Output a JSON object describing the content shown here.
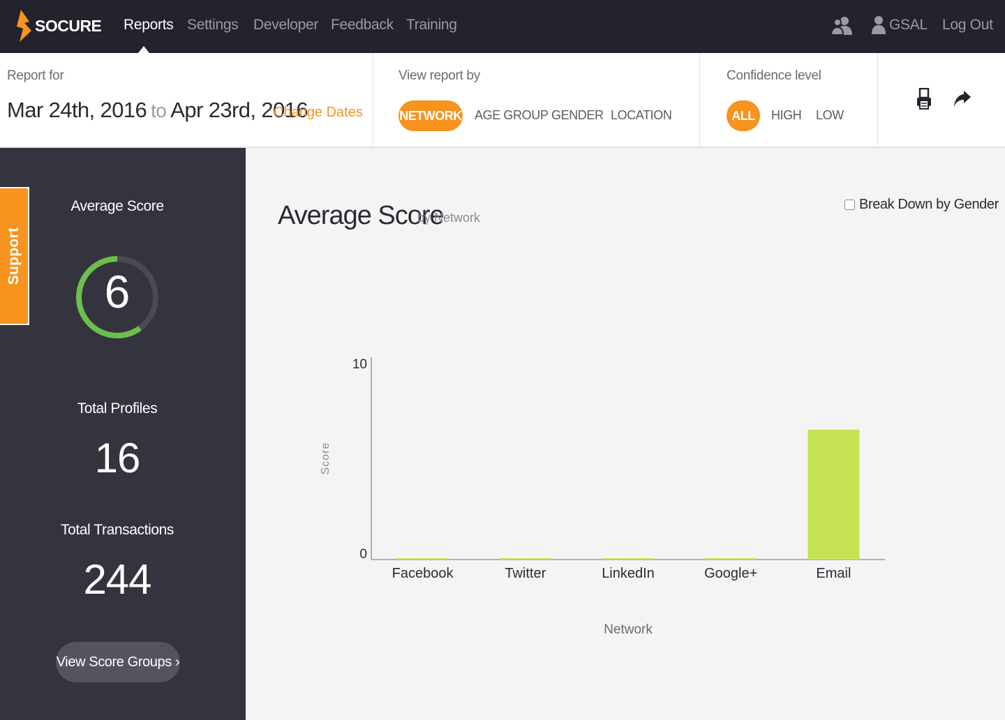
{
  "brand": {
    "name": "SOCURE",
    "accent": "#f7931e"
  },
  "nav": {
    "items": [
      {
        "label": "Reports",
        "active": true
      },
      {
        "label": "Settings"
      },
      {
        "label": "Developer"
      },
      {
        "label": "Feedback"
      },
      {
        "label": "Training"
      }
    ],
    "user_label": "GSAL",
    "logout_label": "Log Out",
    "icons": [
      "users-icon",
      "user-icon"
    ]
  },
  "report": {
    "label": "Report for",
    "start_date": "Mar 24th, 2016",
    "to": "to",
    "end_date": "Apr 23rd, 2016",
    "change_dates": "Change Dates"
  },
  "view_by": {
    "label": "View report by",
    "options": [
      "NETWORK",
      "AGE GROUP",
      "GENDER",
      "LOCATION"
    ],
    "selected": "NETWORK"
  },
  "confidence": {
    "label": "Confidence level",
    "options": [
      "ALL",
      "HIGH",
      "LOW"
    ],
    "selected": "ALL"
  },
  "tools": [
    "print-icon",
    "share-icon"
  ],
  "sidebar": {
    "support": "Support",
    "average_score_label": "Average Score",
    "average_score": "6",
    "gauge_fraction": 0.6,
    "total_profiles_label": "Total Profiles",
    "total_profiles": "16",
    "total_transactions_label": "Total Transactions",
    "total_transactions": "244",
    "view_groups": "View Score Groups ›"
  },
  "main": {
    "title": "Average Score",
    "subtitle": "by Network",
    "breakdown_label": "Break Down by Gender"
  },
  "chart_data": {
    "type": "bar",
    "categories": [
      "Facebook",
      "Twitter",
      "LinkedIn",
      "Google+",
      "Email"
    ],
    "values": [
      0.05,
      0.05,
      0.05,
      0.05,
      6.6
    ],
    "xlabel": "Network",
    "ylabel": "Score",
    "ylim": [
      0,
      10
    ],
    "yticks": [
      "10",
      "0"
    ],
    "bar_color": "#c5e255",
    "grid": false
  }
}
